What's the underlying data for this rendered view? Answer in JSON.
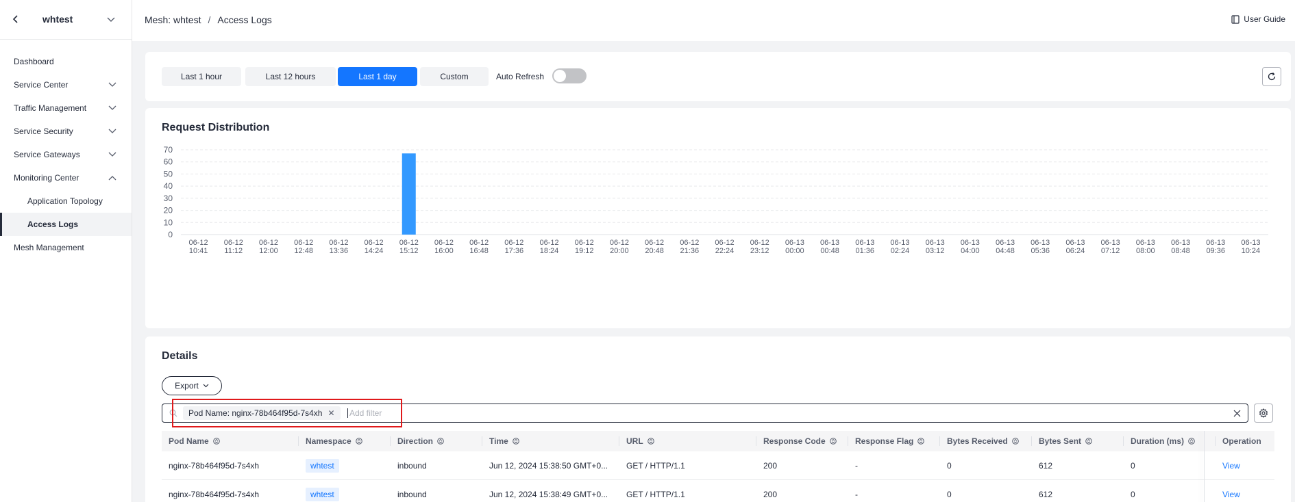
{
  "sidebar": {
    "title": "whtest",
    "items": [
      {
        "label": "Dashboard"
      },
      {
        "label": "Service Center"
      },
      {
        "label": "Traffic Management"
      },
      {
        "label": "Service Security"
      },
      {
        "label": "Service Gateways"
      },
      {
        "label": "Monitoring Center"
      },
      {
        "label": "Application Topology"
      },
      {
        "label": "Access Logs"
      },
      {
        "label": "Mesh Management"
      }
    ]
  },
  "header": {
    "breadcrumb_mesh": "Mesh: whtest",
    "breadcrumb_sep": "/",
    "breadcrumb_page": "Access Logs",
    "user_guide": "User Guide"
  },
  "time_filter": {
    "options": [
      "Last 1 hour",
      "Last 12 hours",
      "Last 1 day",
      "Custom"
    ],
    "selected": "Last 1 day",
    "auto_refresh_label": "Auto Refresh",
    "auto_refresh_on": false
  },
  "chart_title": "Request Distribution",
  "chart_data": {
    "type": "bar",
    "title": "Request Distribution",
    "ylim": [
      0,
      70
    ],
    "yticks": [
      0,
      10,
      20,
      30,
      40,
      50,
      60,
      70
    ],
    "categories": [
      [
        "06-12",
        "10:41"
      ],
      [
        "06-12",
        "11:12"
      ],
      [
        "06-12",
        "12:00"
      ],
      [
        "06-12",
        "12:48"
      ],
      [
        "06-12",
        "13:36"
      ],
      [
        "06-12",
        "14:24"
      ],
      [
        "06-12",
        "15:12"
      ],
      [
        "06-12",
        "16:00"
      ],
      [
        "06-12",
        "16:48"
      ],
      [
        "06-12",
        "17:36"
      ],
      [
        "06-12",
        "18:24"
      ],
      [
        "06-12",
        "19:12"
      ],
      [
        "06-12",
        "20:00"
      ],
      [
        "06-12",
        "20:48"
      ],
      [
        "06-12",
        "21:36"
      ],
      [
        "06-12",
        "22:24"
      ],
      [
        "06-12",
        "23:12"
      ],
      [
        "06-13",
        "00:00"
      ],
      [
        "06-13",
        "00:48"
      ],
      [
        "06-13",
        "01:36"
      ],
      [
        "06-13",
        "02:24"
      ],
      [
        "06-13",
        "03:12"
      ],
      [
        "06-13",
        "04:00"
      ],
      [
        "06-13",
        "04:48"
      ],
      [
        "06-13",
        "05:36"
      ],
      [
        "06-13",
        "06:24"
      ],
      [
        "06-13",
        "07:12"
      ],
      [
        "06-13",
        "08:00"
      ],
      [
        "06-13",
        "08:48"
      ],
      [
        "06-13",
        "09:36"
      ],
      [
        "06-13",
        "10:24"
      ]
    ],
    "values": [
      0,
      0,
      0,
      0,
      0,
      0,
      67,
      0,
      0,
      0,
      0,
      0,
      0,
      0,
      0,
      0,
      0,
      0,
      0,
      0,
      0,
      0,
      0,
      0,
      0,
      0,
      0,
      0,
      0,
      0,
      0
    ],
    "grid": true,
    "bar_color": "#3399ff"
  },
  "details": {
    "title": "Details",
    "export_label": "Export",
    "filter_chip": "Pod Name: nginx-78b464f95d-7s4xh",
    "add_filter_placeholder": "Add filter",
    "columns": [
      "Pod Name",
      "Namespace",
      "Direction",
      "Time",
      "URL",
      "Response Code",
      "Response Flag",
      "Bytes Received",
      "Bytes Sent",
      "Duration (ms)",
      "Operation"
    ],
    "rows": [
      [
        "nginx-78b464f95d-7s4xh",
        "whtest",
        "inbound",
        "Jun 12, 2024 15:38:50 GMT+0...",
        "GET / HTTP/1.1",
        "200",
        "-",
        "0",
        "612",
        "0",
        "View"
      ],
      [
        "nginx-78b464f95d-7s4xh",
        "whtest",
        "inbound",
        "Jun 12, 2024 15:38:49 GMT+0...",
        "GET / HTTP/1.1",
        "200",
        "-",
        "0",
        "612",
        "0",
        "View"
      ]
    ]
  },
  "colors": {
    "accent": "#1476ff",
    "highlight_box": "#e0191b"
  },
  "icons": [
    "back-arrow-icon",
    "chevron-down-icon",
    "chevron-up-icon",
    "book-icon",
    "refresh-icon",
    "search-icon",
    "close-icon",
    "settings-gear-icon",
    "sort-icon"
  ]
}
